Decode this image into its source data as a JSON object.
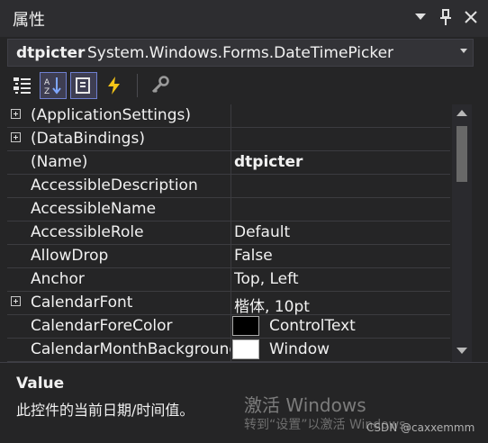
{
  "panel": {
    "title": "属性",
    "icons": [
      "dropdown-arrow-icon",
      "pin-icon",
      "close-icon"
    ]
  },
  "object_selector": {
    "name": "dtpicter",
    "type": "System.Windows.Forms.DateTimePicker"
  },
  "toolbar": {
    "buttons": [
      {
        "name": "categorized-view-icon",
        "active": false
      },
      {
        "name": "alphabetical-sort-icon",
        "active": true
      },
      {
        "name": "properties-icon",
        "active": true
      },
      {
        "name": "events-icon",
        "active": false
      },
      {
        "name": "property-pages-icon",
        "active": false
      }
    ]
  },
  "properties": [
    {
      "name": "(ApplicationSettings)",
      "value": "",
      "expandable": true
    },
    {
      "name": "(DataBindings)",
      "value": "",
      "expandable": true
    },
    {
      "name": "(Name)",
      "value": "dtpicter",
      "bold": true
    },
    {
      "name": "AccessibleDescription",
      "value": ""
    },
    {
      "name": "AccessibleName",
      "value": ""
    },
    {
      "name": "AccessibleRole",
      "value": "Default"
    },
    {
      "name": "AllowDrop",
      "value": "False"
    },
    {
      "name": "Anchor",
      "value": "Top, Left"
    },
    {
      "name": "CalendarFont",
      "value": "楷体, 10pt",
      "expandable": true
    },
    {
      "name": "CalendarForeColor",
      "value": "ControlText",
      "swatch": "#000000"
    },
    {
      "name": "CalendarMonthBackground",
      "value": "Window",
      "swatch": "#ffffff"
    }
  ],
  "description": {
    "title": "Value",
    "text": "此控件的当前日期/时间值。"
  },
  "watermark": {
    "line1": "激活 Windows",
    "line2": "转到“设置”以激活 Windows。",
    "credit": "CSDN @caxxemmm"
  }
}
